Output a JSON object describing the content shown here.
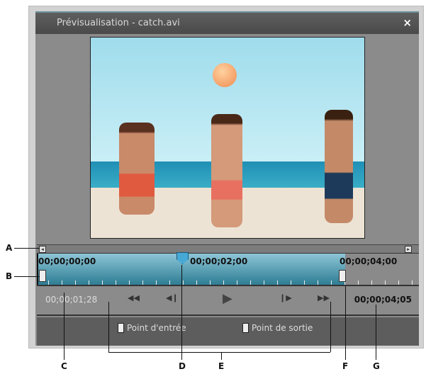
{
  "window": {
    "title": "Prévisualisation - catch.avi",
    "close": "×"
  },
  "timeline": {
    "start": "00;00;00;00",
    "mid": "00;00;02;00",
    "end": "00;00;04;00",
    "scroll_left": "◂",
    "scroll_right": "▸",
    "playhead_fraction": 0.48
  },
  "controls": {
    "current_time": "00;00;01;28",
    "duration": "00;00;04;05",
    "rewind": "◀◀",
    "step_back": "◀❙",
    "play": "▶",
    "step_forward": "❙▶",
    "fast_forward": "▶▶"
  },
  "bottom": {
    "in_point": "Point d'entrée",
    "out_point": "Point de sortie"
  },
  "callouts": [
    "A",
    "B",
    "C",
    "D",
    "E",
    "F",
    "G"
  ],
  "colors": {
    "timeline_blue": "#2e7d94",
    "playhead": "#47a9d6"
  }
}
